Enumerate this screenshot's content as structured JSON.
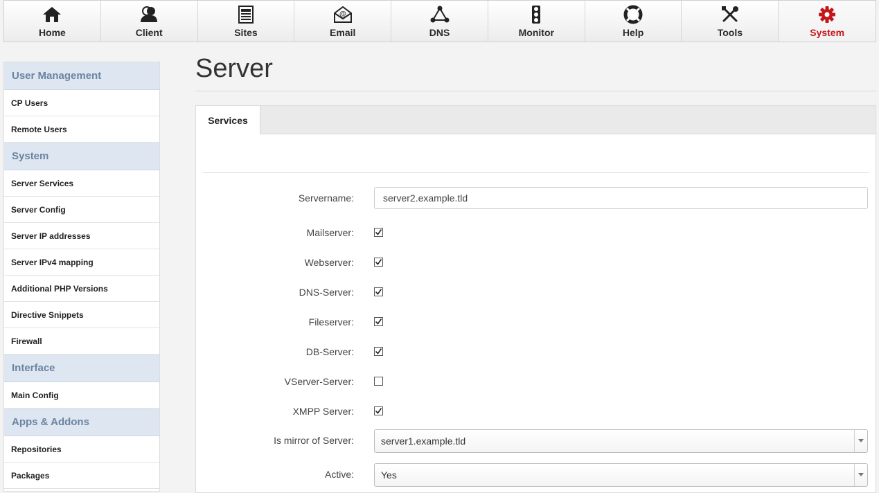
{
  "topnav": {
    "items": [
      {
        "label": "Home",
        "icon": "home-icon"
      },
      {
        "label": "Client",
        "icon": "users-icon"
      },
      {
        "label": "Sites",
        "icon": "document-icon"
      },
      {
        "label": "Email",
        "icon": "envelope-icon"
      },
      {
        "label": "DNS",
        "icon": "network-icon"
      },
      {
        "label": "Monitor",
        "icon": "traffic-light-icon"
      },
      {
        "label": "Help",
        "icon": "lifebuoy-icon"
      },
      {
        "label": "Tools",
        "icon": "wrench-screwdriver-icon"
      },
      {
        "label": "System",
        "icon": "gear-icon",
        "active": true
      }
    ],
    "active_color": "#c5161c"
  },
  "sidebar": {
    "sections": [
      {
        "title": "User Management",
        "items": [
          "CP Users",
          "Remote Users"
        ]
      },
      {
        "title": "System",
        "items": [
          "Server Services",
          "Server Config",
          "Server IP addresses",
          "Server IPv4 mapping",
          "Additional PHP Versions",
          "Directive Snippets",
          "Firewall"
        ]
      },
      {
        "title": "Interface",
        "items": [
          "Main Config"
        ]
      },
      {
        "title": "Apps & Addons",
        "items": [
          "Repositories",
          "Packages"
        ]
      }
    ]
  },
  "main": {
    "title": "Server",
    "tab": "Services",
    "form": {
      "servername_label": "Servername:",
      "servername_value": "server2.example.tld",
      "checkboxes": [
        {
          "label": "Mailserver:",
          "checked": true
        },
        {
          "label": "Webserver:",
          "checked": true
        },
        {
          "label": "DNS-Server:",
          "checked": true
        },
        {
          "label": "Fileserver:",
          "checked": true
        },
        {
          "label": "DB-Server:",
          "checked": true
        },
        {
          "label": "VServer-Server:",
          "checked": false
        },
        {
          "label": "XMPP Server:",
          "checked": true
        }
      ],
      "mirror_label": "Is mirror of Server:",
      "mirror_value": "server1.example.tld",
      "active_label": "Active:",
      "active_value": "Yes"
    }
  }
}
